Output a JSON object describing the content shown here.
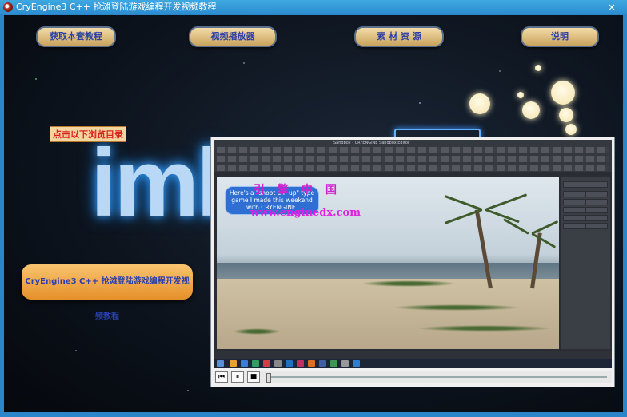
{
  "window": {
    "title": "CryEngine3 C++ 抢滩登陆游戏编程开发视频教程",
    "close_glyph": "×"
  },
  "nav": [
    {
      "label": "获取本套教程"
    },
    {
      "label": "视频播放器"
    },
    {
      "label": "素 材 资 源"
    },
    {
      "label": "说明"
    }
  ],
  "logo_text": "iml",
  "catalog_tag": "点击以下浏览目录",
  "course_button": "CryEngine3 C++ 抢滩登陆游戏编程开发视频教程",
  "video": {
    "speech_bubble": "Here's a \"shoot em up\" type game I made this weekend with CRYENGINE.",
    "watermark_cn": "引擎中国",
    "watermark_url": "www.enginedx.com",
    "editor_title": "Sandbox - CRYENGINE Sandbox Editor"
  },
  "player_controls": {
    "prev_glyph": "⏮",
    "pause_glyph": "⏸",
    "stop_glyph": "■"
  },
  "colors": {
    "titlebar": "#3fa7e0",
    "nav_text": "#2c3fa6",
    "tag_text": "#d8241c",
    "watermark": "#e020e0"
  }
}
